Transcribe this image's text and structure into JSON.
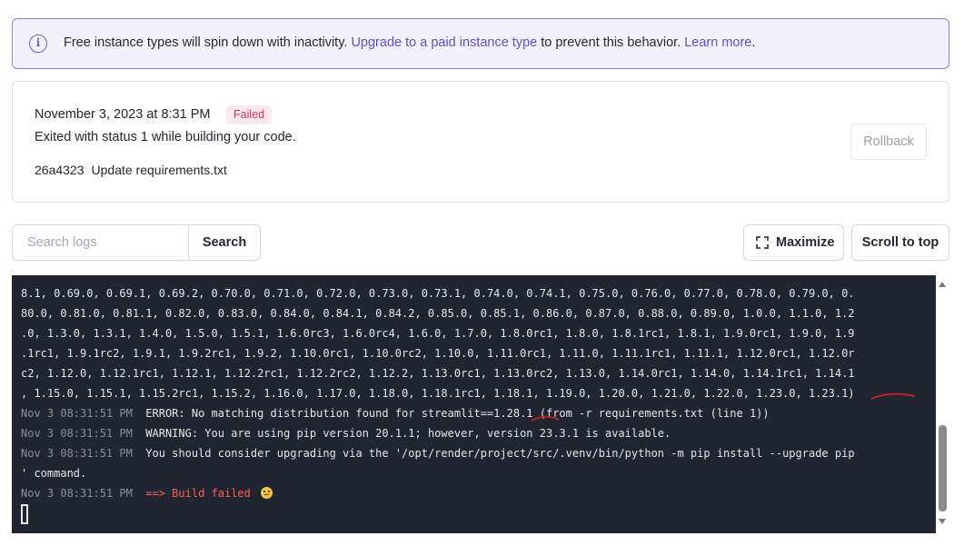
{
  "banner": {
    "prefix": "Free instance types will spin down with inactivity. ",
    "link_upgrade": "Upgrade to a paid instance type",
    "middle": " to prevent this behavior. ",
    "link_learn": "Learn more",
    "suffix": "."
  },
  "deploy": {
    "date": "November 3, 2023 at 8:31 PM",
    "status": "Failed",
    "message": "Exited with status 1 while building your code.",
    "commit_hash": "26a4323",
    "commit_message": "Update requirements.txt",
    "rollback_label": "Rollback"
  },
  "toolbar": {
    "search_placeholder": "Search logs",
    "search_label": "Search",
    "maximize_label": "Maximize",
    "scroll_top_label": "Scroll to top"
  },
  "logs": {
    "wrapped": [
      "8.1, 0.69.0, 0.69.1, 0.69.2, 0.70.0, 0.71.0, 0.72.0, 0.73.0, 0.73.1, 0.74.0, 0.74.1, 0.75.0, 0.76.0, 0.77.0, 0.78.0, 0.79.0, 0.",
      "80.0, 0.81.0, 0.81.1, 0.82.0, 0.83.0, 0.84.0, 0.84.1, 0.84.2, 0.85.0, 0.85.1, 0.86.0, 0.87.0, 0.88.0, 0.89.0, 1.0.0, 1.1.0, 1.2",
      ".0, 1.3.0, 1.3.1, 1.4.0, 1.5.0, 1.5.1, 1.6.0rc3, 1.6.0rc4, 1.6.0, 1.7.0, 1.8.0rc1, 1.8.0, 1.8.1rc1, 1.8.1, 1.9.0rc1, 1.9.0, 1.9",
      ".1rc1, 1.9.1rc2, 1.9.1, 1.9.2rc1, 1.9.2, 1.10.0rc1, 1.10.0rc2, 1.10.0, 1.11.0rc1, 1.11.0, 1.11.1rc1, 1.11.1, 1.12.0rc1, 1.12.0r",
      "c2, 1.12.0, 1.12.1rc1, 1.12.1, 1.12.2rc1, 1.12.2rc2, 1.12.2, 1.13.0rc1, 1.13.0rc2, 1.13.0, 1.14.0rc1, 1.14.0, 1.14.1rc1, 1.14.1",
      ", 1.15.0, 1.15.1, 1.15.2rc1, 1.15.2, 1.16.0, 1.17.0, 1.18.0, 1.18.1rc1, 1.18.1, 1.19.0, 1.20.0, 1.21.0, 1.22.0, 1.23.0, 1.23.1)"
    ],
    "error_ts": "Nov 3 08:31:51 PM",
    "error_text": "ERROR: No matching distribution found for streamlit==1.28.1 (from -r requirements.txt (line 1))",
    "warning_ts": "Nov 3 08:31:51 PM",
    "warning_text": "WARNING: You are using pip version 20.1.1; however, version 23.3.1 is available.",
    "upgrade_ts": "Nov 3 08:31:51 PM",
    "upgrade_text": "You should consider upgrading via the '/opt/render/project/src/.venv/bin/python -m pip install --upgrade pip",
    "upgrade_cont": "' command.",
    "fail_ts": "Nov 3 08:31:51 PM",
    "fail_text": "==> Build failed"
  },
  "colors": {
    "accent": "#5b4fd1",
    "failed_badge": "#d6335c",
    "log_bg": "#212431",
    "error_text": "#ff5c57"
  },
  "icons": [
    "info-icon",
    "expand-icon",
    "disappointed-face-emoji"
  ]
}
